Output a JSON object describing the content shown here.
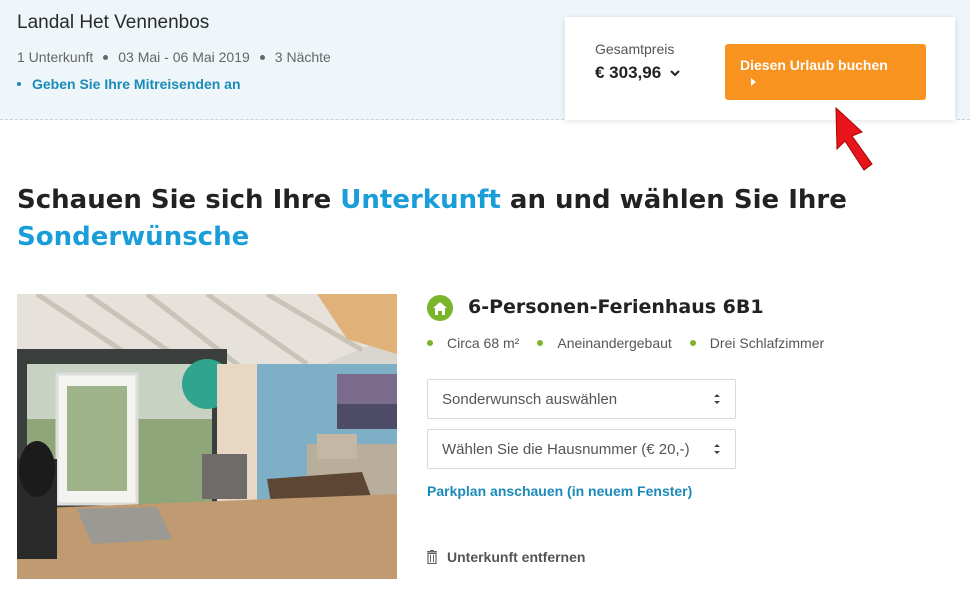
{
  "summary": {
    "park_name": "Landal Het Vennenbos",
    "accommodations": "1 Unterkunft",
    "dates": "03 Mai - 06 Mai 2019",
    "nights": "3 Nächte",
    "travelers_link": "Geben Sie Ihre Mitreisenden an"
  },
  "price": {
    "label": "Gesamtpreis",
    "value": "€ 303,96",
    "book_label": "Diesen Urlaub buchen"
  },
  "headline": {
    "part1": "Schauen Sie sich Ihre ",
    "highlight1": "Unterkunft",
    "part2": " an und wählen Sie Ihre ",
    "highlight2": "Sonderwünsche"
  },
  "house": {
    "title": "6-Personen-Ferienhaus 6B1",
    "features": [
      "Circa 68 m²",
      "Aneinandergebaut",
      "Drei Schlafzimmer"
    ],
    "select_special": "Sonderwunsch auswählen",
    "select_number": "Wählen Sie die Hausnummer (€ 20,-)",
    "parkplan_link": "Parkplan anschauen (in neuem Fenster)",
    "remove_label": "Unterkunft entfernen"
  },
  "colors": {
    "accent_blue": "#1a9ed9",
    "book_orange": "#f7931e",
    "green": "#7ab52b",
    "arrow_red": "#e8141c"
  }
}
